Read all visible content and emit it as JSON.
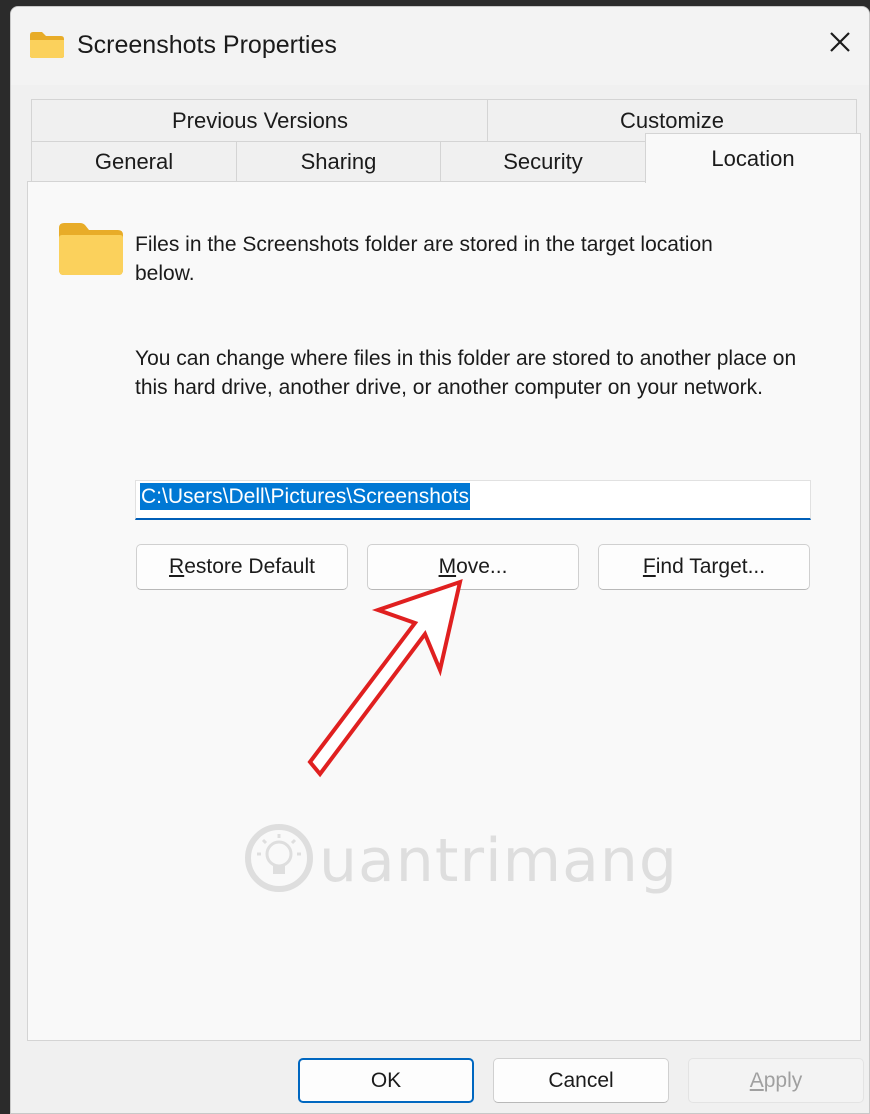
{
  "window": {
    "title": "Screenshots Properties"
  },
  "tabs": {
    "row1": [
      {
        "label": "Previous Versions"
      },
      {
        "label": "Customize"
      }
    ],
    "row2": [
      {
        "label": "General"
      },
      {
        "label": "Sharing"
      },
      {
        "label": "Security"
      },
      {
        "label": "Location",
        "active": true
      }
    ]
  },
  "location": {
    "intro": "Files in the Screenshots folder are stored in the target location below.",
    "description": "You can change where files in this folder are stored to another place on this hard drive, another drive, or another computer on your network.",
    "path": "C:\\Users\\Dell\\Pictures\\Screenshots",
    "restore_prefix": "R",
    "restore_rest": "estore Default",
    "move_prefix": "M",
    "move_rest": "ove...",
    "find_prefix": "F",
    "find_rest": "ind Target..."
  },
  "footer": {
    "ok": "OK",
    "cancel": "Cancel",
    "apply_prefix": "A",
    "apply_rest": "pply"
  },
  "watermark": {
    "text": "uantrimang"
  },
  "colors": {
    "accent": "#0078d4",
    "annotation_arrow": "#e02020",
    "folder": "#f8c849"
  },
  "icons": {
    "title": "folder-icon",
    "close": "close-icon",
    "content": "folder-icon",
    "watermark": "lightbulb-icon"
  }
}
